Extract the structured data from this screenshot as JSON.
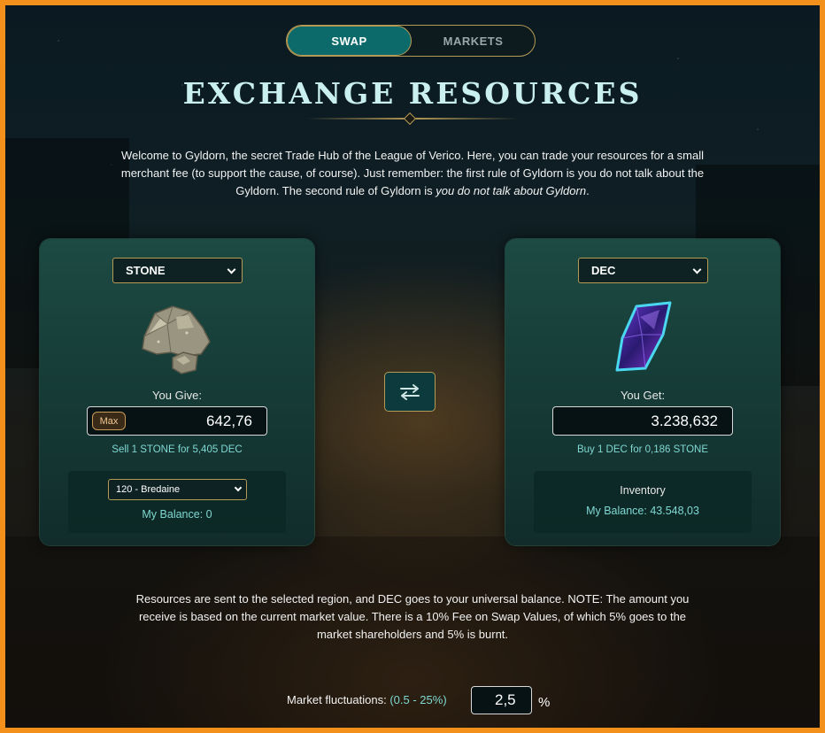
{
  "tabs": [
    {
      "label": "SWAP",
      "active": true
    },
    {
      "label": "MARKETS",
      "active": false
    }
  ],
  "title": "EXCHANGE RESOURCES",
  "intro": {
    "part1": "Welcome to Gyldorn, the secret Trade Hub of the League of Verico. Here, you can trade your resources for a small merchant fee (to support the cause, of course). Just remember: the first rule of Gyldorn is you do not talk about the Gyldorn. The second rule of Gyldorn is ",
    "emphasis": "you do not talk about Gyldorn",
    "end": "."
  },
  "give_panel": {
    "resource": "STONE",
    "icon": "stone-icon",
    "label": "You Give:",
    "max_label": "Max",
    "amount": "642,76",
    "rate": "Sell 1 STONE for 5,405 DEC",
    "region": "120 - Bredaine",
    "balance": "My Balance: 0"
  },
  "get_panel": {
    "resource": "DEC",
    "icon": "dec-crystal-icon",
    "label": "You Get:",
    "amount": "3.238,632",
    "rate": "Buy 1 DEC for 0,186 STONE",
    "inventory_title": "Inventory",
    "balance": "My Balance: 43.548,03"
  },
  "swap_icon": "swap-arrows-icon",
  "note": "Resources are sent to the selected region, and DEC goes to your universal balance. NOTE: The amount you receive is based on the current market value. There is a 10% Fee on Swap Values, of which 5% goes to the market shareholders and 5% is burnt.",
  "fluctuation": {
    "label": "Market fluctuations:",
    "range": "(0.5 - 25%)",
    "value": "2,5",
    "unit": "%"
  },
  "colors": {
    "accent_teal": "#0c6b6a",
    "gold_border": "#b59a55",
    "info_text": "#7fd8d2",
    "frame_orange": "#f3901c"
  }
}
